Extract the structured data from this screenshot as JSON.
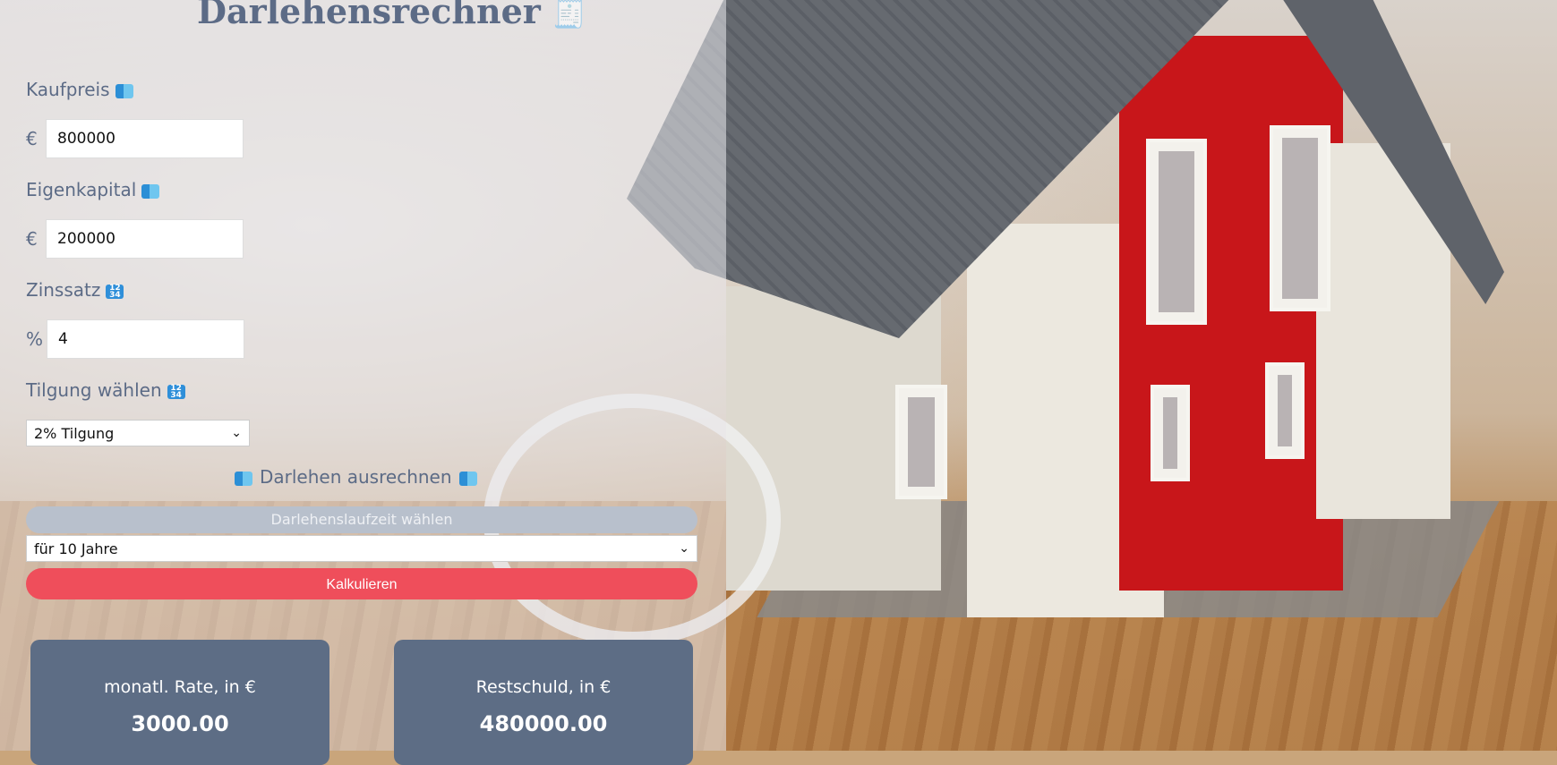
{
  "app": {
    "title": "Darlehensrechner",
    "title_icon": "receipt-icon"
  },
  "fields": {
    "kaufpreis": {
      "label": "Kaufpreis",
      "unit": "€",
      "value": "800000",
      "icon": "money-icon"
    },
    "eigenkapital": {
      "label": "Eigenkapital",
      "unit": "€",
      "value": "200000",
      "icon": "money-icon"
    },
    "zinssatz": {
      "label": "Zinssatz",
      "unit": "%",
      "value": "4",
      "icon": "numbers-icon"
    },
    "tilgung": {
      "label": "Tilgung wählen",
      "selected": "2% Tilgung",
      "icon": "numbers-icon"
    }
  },
  "calc": {
    "heading": "Darlehen ausrechnen",
    "duration_label": "Darlehenslaufzeit wählen",
    "duration_selected": "für 10 Jahre",
    "button_label": "Kalkulieren"
  },
  "results": {
    "rate": {
      "caption": "monatl. Rate, in €",
      "value": "3000.00"
    },
    "restschuld": {
      "caption": "Restschuld, in €",
      "value": "480000.00"
    }
  },
  "colors": {
    "accent": "#ef4e5b",
    "text": "#5c6b86",
    "card": "#5d6d85"
  }
}
